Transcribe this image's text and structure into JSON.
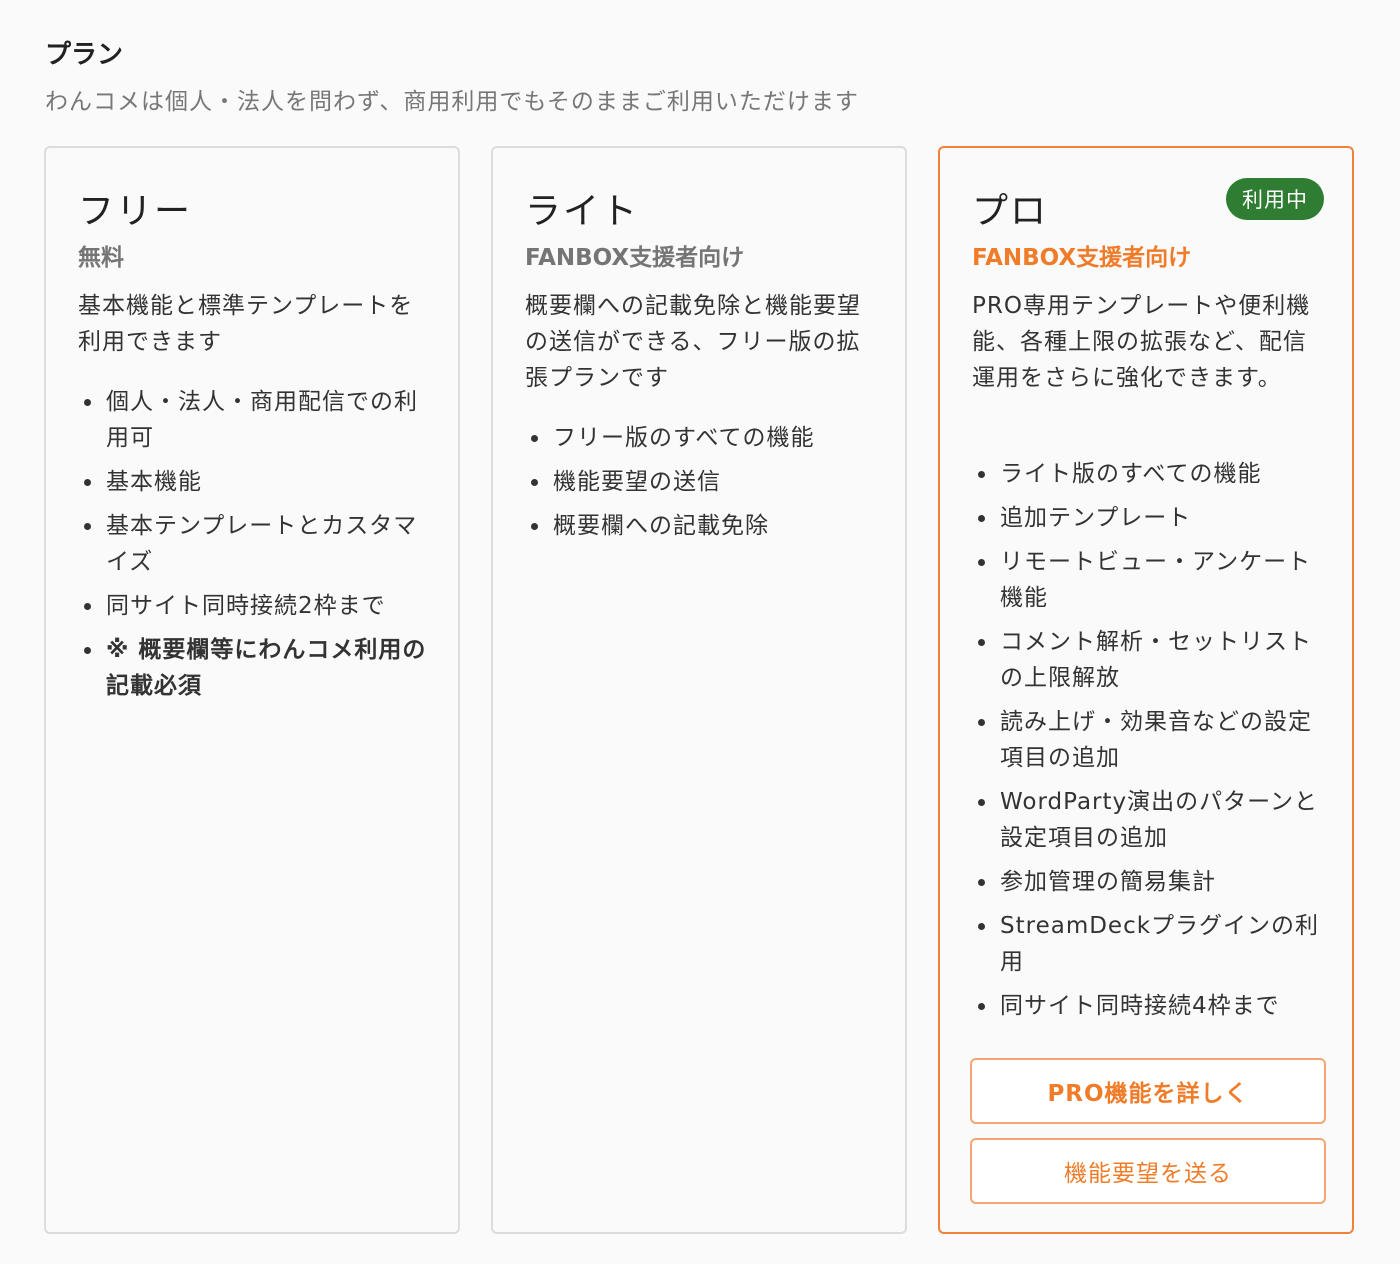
{
  "section": {
    "title": "プラン",
    "subtitle": "わんコメは個人・法人を問わず、商用利用でもそのままご利用いただけます"
  },
  "plans": {
    "free": {
      "name": "フリー",
      "price": "無料",
      "description": "基本機能と標準テンプレートを利用できます",
      "features": [
        "個人・法人・商用配信での利用可",
        "基本機能",
        "基本テンプレートとカスタマイズ",
        "同サイト同時接続2枠まで",
        "※ 概要欄等にわんコメ利用の記載必須"
      ]
    },
    "lite": {
      "name": "ライト",
      "price": "FANBOX支援者向け",
      "description": "概要欄への記載免除と機能要望の送信ができる、フリー版の拡張プランです",
      "features": [
        "フリー版のすべての機能",
        "機能要望の送信",
        "概要欄への記載免除"
      ]
    },
    "pro": {
      "name": "プロ",
      "badge": "利用中",
      "price": "FANBOX支援者向け",
      "description": "PRO専用テンプレートや便利機能、各種上限の拡張など、配信運用をさらに強化できます。",
      "features": [
        "ライト版のすべての機能",
        "追加テンプレート",
        "リモートビュー・アンケート機能",
        "コメント解析・セットリストの上限解放",
        "読み上げ・効果音などの設定項目の追加",
        "WordParty演出のパターンと設定項目の追加",
        "参加管理の簡易集計",
        "StreamDeckプラグインの利用",
        "同サイト同時接続4枠まで"
      ],
      "details_button": "PRO機能を詳しく",
      "request_button": "機能要望を送る"
    }
  },
  "colors": {
    "accent": "#f07c2a",
    "badge": "#2e7d32",
    "border": "#dcdcdc"
  }
}
